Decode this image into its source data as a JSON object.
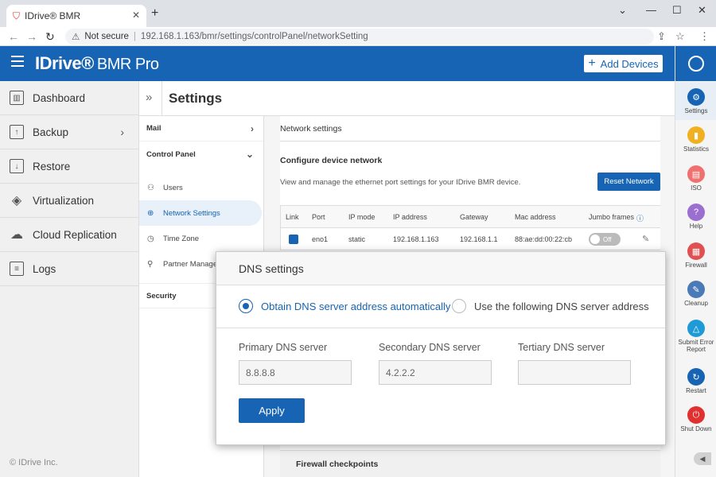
{
  "browser": {
    "tab_title": "IDrive® BMR",
    "security": "Not secure",
    "url": "192.168.1.163/bmr/settings/controlPanel/networkSetting"
  },
  "header": {
    "logo_main": "IDrive®",
    "logo_sub": "BMR Pro",
    "add_devices": "Add Devices"
  },
  "sidebar": {
    "items": [
      {
        "label": "Dashboard"
      },
      {
        "label": "Backup"
      },
      {
        "label": "Restore"
      },
      {
        "label": "Virtualization"
      },
      {
        "label": "Cloud Replication"
      },
      {
        "label": "Logs"
      }
    ],
    "copyright": "© IDrive Inc."
  },
  "page": {
    "title": "Settings"
  },
  "submenu": {
    "mail": "Mail",
    "control_panel": "Control Panel",
    "users": "Users",
    "network_settings": "Network Settings",
    "time_zone": "Time Zone",
    "partner_manage": "Partner Manage",
    "security": "Security"
  },
  "network": {
    "section_title": "Network settings",
    "configure_title": "Configure device network",
    "description": "View and manage the ethernet port settings for your IDrive BMR device.",
    "reset_button": "Reset Network",
    "columns": [
      "Link",
      "Port",
      "IP mode",
      "IP address",
      "Gateway",
      "Mac address",
      "Jumbo frames"
    ],
    "row": {
      "port": "eno1",
      "ip_mode": "static",
      "ip_address": "192.168.1.163",
      "gateway": "192.168.1.1",
      "mac": "88:ae:dd:00:22:cb",
      "jumbo": "Off"
    },
    "firewall_title": "Firewall checkpoints"
  },
  "rightbar": {
    "items": [
      {
        "label": "Settings",
        "color": "#1664b3"
      },
      {
        "label": "Statistics",
        "color": "#f0b020"
      },
      {
        "label": "ISO",
        "color": "#f07070"
      },
      {
        "label": "Help",
        "color": "#9b6fcf"
      },
      {
        "label": "Firewall",
        "color": "#e05050"
      },
      {
        "label": "Cleanup",
        "color": "#4a7ab8"
      },
      {
        "label": "Submit Error Report",
        "color": "#1e9ad6"
      },
      {
        "label": "Restart",
        "color": "#1664b3"
      },
      {
        "label": "Shut Down",
        "color": "#e03030"
      }
    ]
  },
  "dns": {
    "title": "DNS settings",
    "option_auto": "Obtain DNS server address automatically",
    "option_manual": "Use the following DNS server address",
    "primary_label": "Primary DNS server",
    "primary_value": "8.8.8.8",
    "secondary_label": "Secondary DNS server",
    "secondary_value": "4.2.2.2",
    "tertiary_label": "Tertiary DNS server",
    "tertiary_value": "",
    "apply": "Apply"
  }
}
